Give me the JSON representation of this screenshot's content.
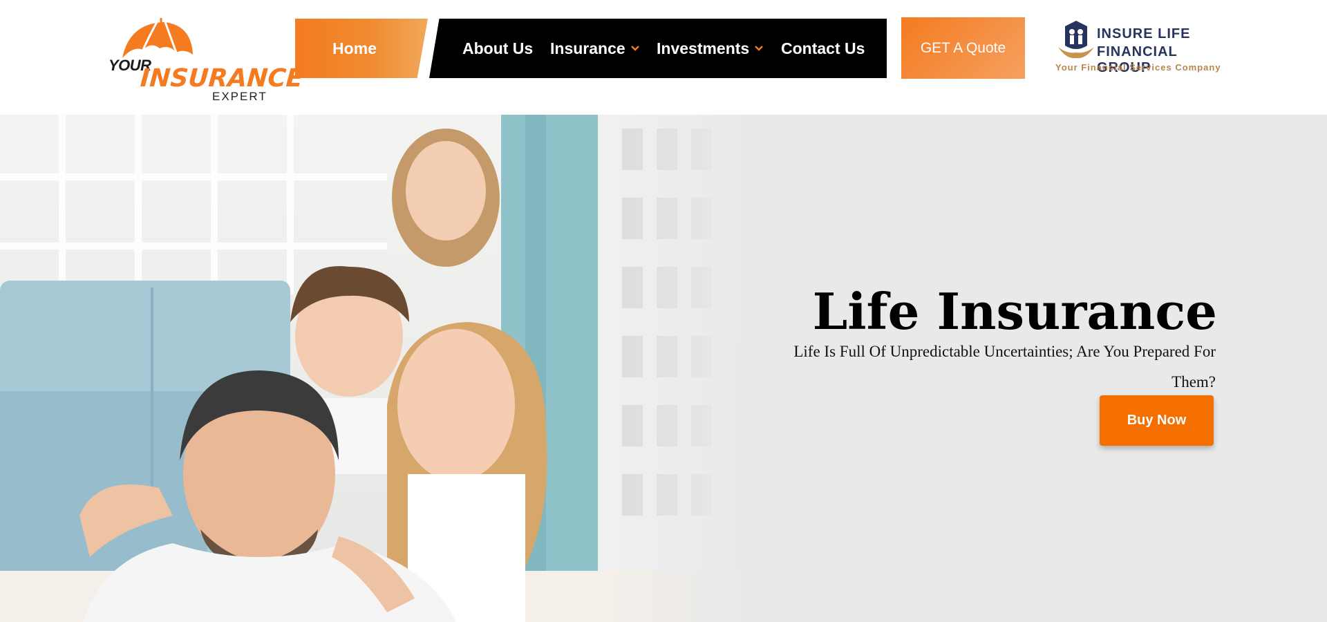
{
  "brand": {
    "logo_top": "YOUR",
    "logo_main": "INSURANCE",
    "logo_bottom": "EXPERT",
    "accent_color": "#f47b20"
  },
  "nav": {
    "items": [
      {
        "label": "Home",
        "active": true
      },
      {
        "label": "About Us"
      },
      {
        "label": "Insurance",
        "has_dropdown": true,
        "icon": "chevron-down-icon"
      },
      {
        "label": "Investments",
        "has_dropdown": true,
        "icon": "chevron-down-icon"
      },
      {
        "label": "Contact Us"
      }
    ],
    "quote_button": "GET A Quote"
  },
  "partner": {
    "line1": "INSURE LIFE",
    "line2": "FINANCIAL GROUP",
    "tagline": "Your Financial Services Company"
  },
  "hero": {
    "title": "Life Insurance",
    "subtitle": "Life Is Full Of Unpredictable Uncertainties; Are You Prepared For Them?",
    "cta": "Buy Now",
    "cta_color": "#f56e00",
    "image": "family-photo"
  }
}
